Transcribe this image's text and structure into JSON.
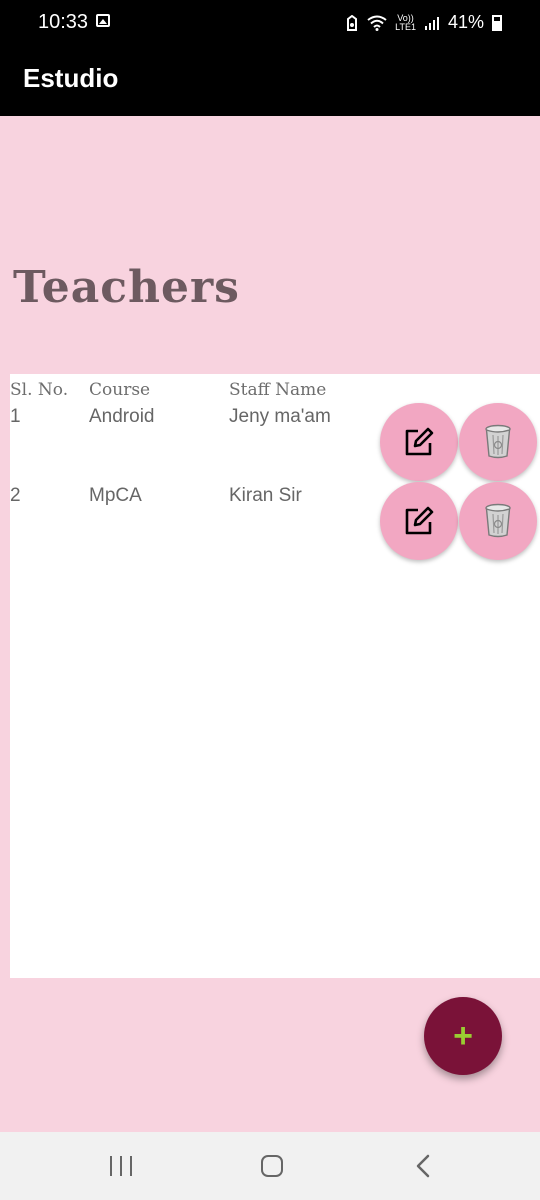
{
  "status_bar": {
    "time": "10:33",
    "lte_top": "Vo))",
    "lte_bottom": "LTE1",
    "battery": "41%"
  },
  "app_bar": {
    "title": "Estudio"
  },
  "page": {
    "heading": "Teachers"
  },
  "table": {
    "headers": {
      "sl": "Sl. No.",
      "course": "Course",
      "staff": "Staff Name"
    },
    "rows": [
      {
        "sl": "1",
        "course": "Android",
        "staff": "Jeny ma'am"
      },
      {
        "sl": "2",
        "course": "MpCA",
        "staff": "Kiran Sir"
      }
    ]
  },
  "icons": {
    "edit": "edit-icon",
    "delete": "trash-bin-icon",
    "add": "plus-icon"
  },
  "colors": {
    "background": "#f8d3df",
    "app_bar": "#000000",
    "action_button": "#f2a7c2",
    "fab": "#7a1238",
    "fab_icon": "#9acd32"
  }
}
